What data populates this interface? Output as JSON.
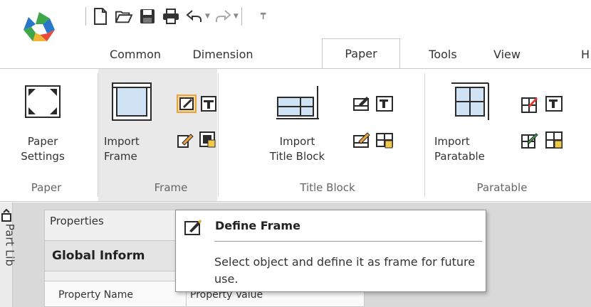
{
  "quick_access": {
    "icons": [
      "new-file-icon",
      "open-folder-icon",
      "save-icon",
      "print-icon",
      "undo-icon",
      "redo-icon",
      "customize-qat-icon"
    ]
  },
  "tabs": [
    {
      "label": "Common",
      "active": false
    },
    {
      "label": "Dimension",
      "active": false
    },
    {
      "label": "Paper",
      "active": true
    },
    {
      "label": "Tools",
      "active": false
    },
    {
      "label": "View",
      "active": false
    },
    {
      "label": "H",
      "active": false
    }
  ],
  "ribbon": {
    "paper_group": {
      "label": "Paper",
      "paper_settings": [
        "Paper",
        "Settings"
      ]
    },
    "frame_group": {
      "label": "Frame",
      "import_frame": [
        "Import",
        "Frame"
      ]
    },
    "title_block_group": {
      "label": "Title Block",
      "import_title_block": [
        "Import",
        "Title Block"
      ]
    },
    "paratable_group": {
      "label": "Paratable",
      "import_paratable": [
        "Import",
        "Paratable"
      ]
    }
  },
  "side_panel": {
    "tab_label": "Part Lib"
  },
  "properties_panel": {
    "title": "Properties",
    "section": "Global Inform",
    "columns": [
      "Property Name",
      "Property Value"
    ]
  },
  "tooltip": {
    "title": "Define Frame",
    "description": "Select object and define it as frame for future use."
  },
  "colors": {
    "accent_orange": "#e8a33d",
    "icon_dark": "#2b2b2b",
    "icon_blue": "#3a7fc1",
    "selected_bg": "#e9e9e9"
  }
}
